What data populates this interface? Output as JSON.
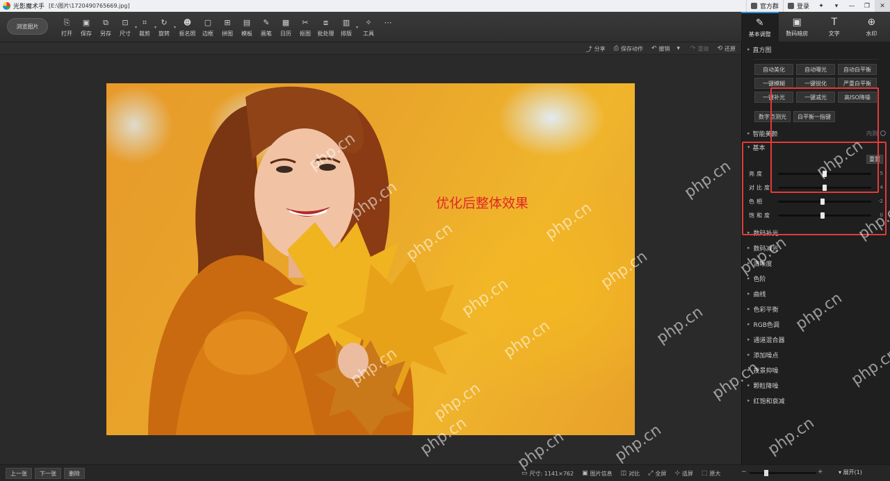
{
  "titlebar": {
    "app_name": "光影魔术手",
    "file_path": "[E:\\图片\\1720490765669.jpg]",
    "official_group": "官方群",
    "login": "登录"
  },
  "toolbar": {
    "browse_label": "浏览图片",
    "tools": [
      {
        "label": "打开",
        "icon": "open-icon",
        "glyph": "⎘"
      },
      {
        "label": "保存",
        "icon": "save-icon",
        "glyph": "▣"
      },
      {
        "label": "另存",
        "icon": "save-as-icon",
        "glyph": "⧉"
      },
      {
        "label": "尺寸",
        "icon": "resize-icon",
        "glyph": "⊡",
        "dropdown": true
      },
      {
        "label": "裁剪",
        "icon": "crop-icon",
        "glyph": "⌗",
        "dropdown": true
      },
      {
        "label": "旋转",
        "icon": "rotate-icon",
        "glyph": "↻",
        "dropdown": true
      },
      {
        "label": "抠名照",
        "icon": "id-photo-icon",
        "glyph": "☻"
      },
      {
        "label": "边框",
        "icon": "border-icon",
        "glyph": "▢"
      },
      {
        "label": "拼图",
        "icon": "collage-icon",
        "glyph": "⊞"
      },
      {
        "label": "模板",
        "icon": "template-icon",
        "glyph": "▤"
      },
      {
        "label": "画笔",
        "icon": "brush-icon",
        "glyph": "✎"
      },
      {
        "label": "日历",
        "icon": "calendar-icon",
        "glyph": "▦"
      },
      {
        "label": "抠图",
        "icon": "cutout-icon",
        "glyph": "✂"
      },
      {
        "label": "批处理",
        "icon": "batch-icon",
        "glyph": "⧈"
      },
      {
        "label": "排版",
        "icon": "layout-icon",
        "glyph": "▥",
        "dropdown": true
      },
      {
        "label": "工具",
        "icon": "tools-icon",
        "glyph": "✧"
      },
      {
        "label": "",
        "icon": "more-icon",
        "glyph": "⋯"
      }
    ],
    "side_tabs": [
      {
        "label": "基本调整",
        "icon": "basic-adjust-icon",
        "glyph": "✎",
        "active": true
      },
      {
        "label": "数码暗房",
        "icon": "darkroom-icon",
        "glyph": "▣",
        "active": false
      },
      {
        "label": "文字",
        "icon": "text-icon",
        "glyph": "T",
        "active": false
      },
      {
        "label": "水印",
        "icon": "watermark-icon",
        "glyph": "⊕",
        "active": false
      }
    ]
  },
  "actionbar": {
    "share": "分享",
    "save_action": "保存动作",
    "undo": "撤销",
    "redo": "重做",
    "restore": "还原"
  },
  "canvas": {
    "overlay_text": "优化后整体效果"
  },
  "panel": {
    "histogram": "直方图",
    "quick_buttons": [
      "自动美化",
      "自动曝光",
      "自动白平衡",
      "一键模糊",
      "一键锐化",
      "严重白平衡",
      "一键补光",
      "一键减光",
      "高ISO降噪"
    ],
    "quick_buttons2": [
      "数字点测光",
      "白平衡一指键"
    ],
    "smart_beauty": "智能美颜",
    "smart_beauty_right": "内测",
    "basic": "基本",
    "reset": "重置",
    "sliders": [
      {
        "name": "亮度",
        "value": "5",
        "fraction": 0.5
      },
      {
        "name": "对比度",
        "value": "4",
        "fraction": 0.5
      },
      {
        "name": "色相",
        "value": "-2",
        "fraction": 0.48
      },
      {
        "name": "饱和度",
        "value": "0",
        "fraction": 0.48
      }
    ],
    "adjustments": [
      "数码补光",
      "数码减光",
      "清晰度",
      "色阶",
      "曲线",
      "色彩平衡",
      "RGB色调",
      "通道混合器",
      "添加噪点",
      "夜景抑噪",
      "颗粒降噪",
      "红饱和衰减"
    ]
  },
  "statusbar": {
    "prev": "上一张",
    "next": "下一张",
    "delete": "删除",
    "size": "尺寸: 1141×762",
    "info": "图片信息",
    "compare": "对比",
    "fullscreen": "全屏",
    "fit": "适屏",
    "original": "原大",
    "expand": "展开(1)",
    "zoom_fraction": 0.25
  },
  "watermarks": "php.cn",
  "colors": {
    "accent": "#2f8fd8",
    "highlight": "#e53a3a",
    "overlay_text": "#e0262a"
  }
}
